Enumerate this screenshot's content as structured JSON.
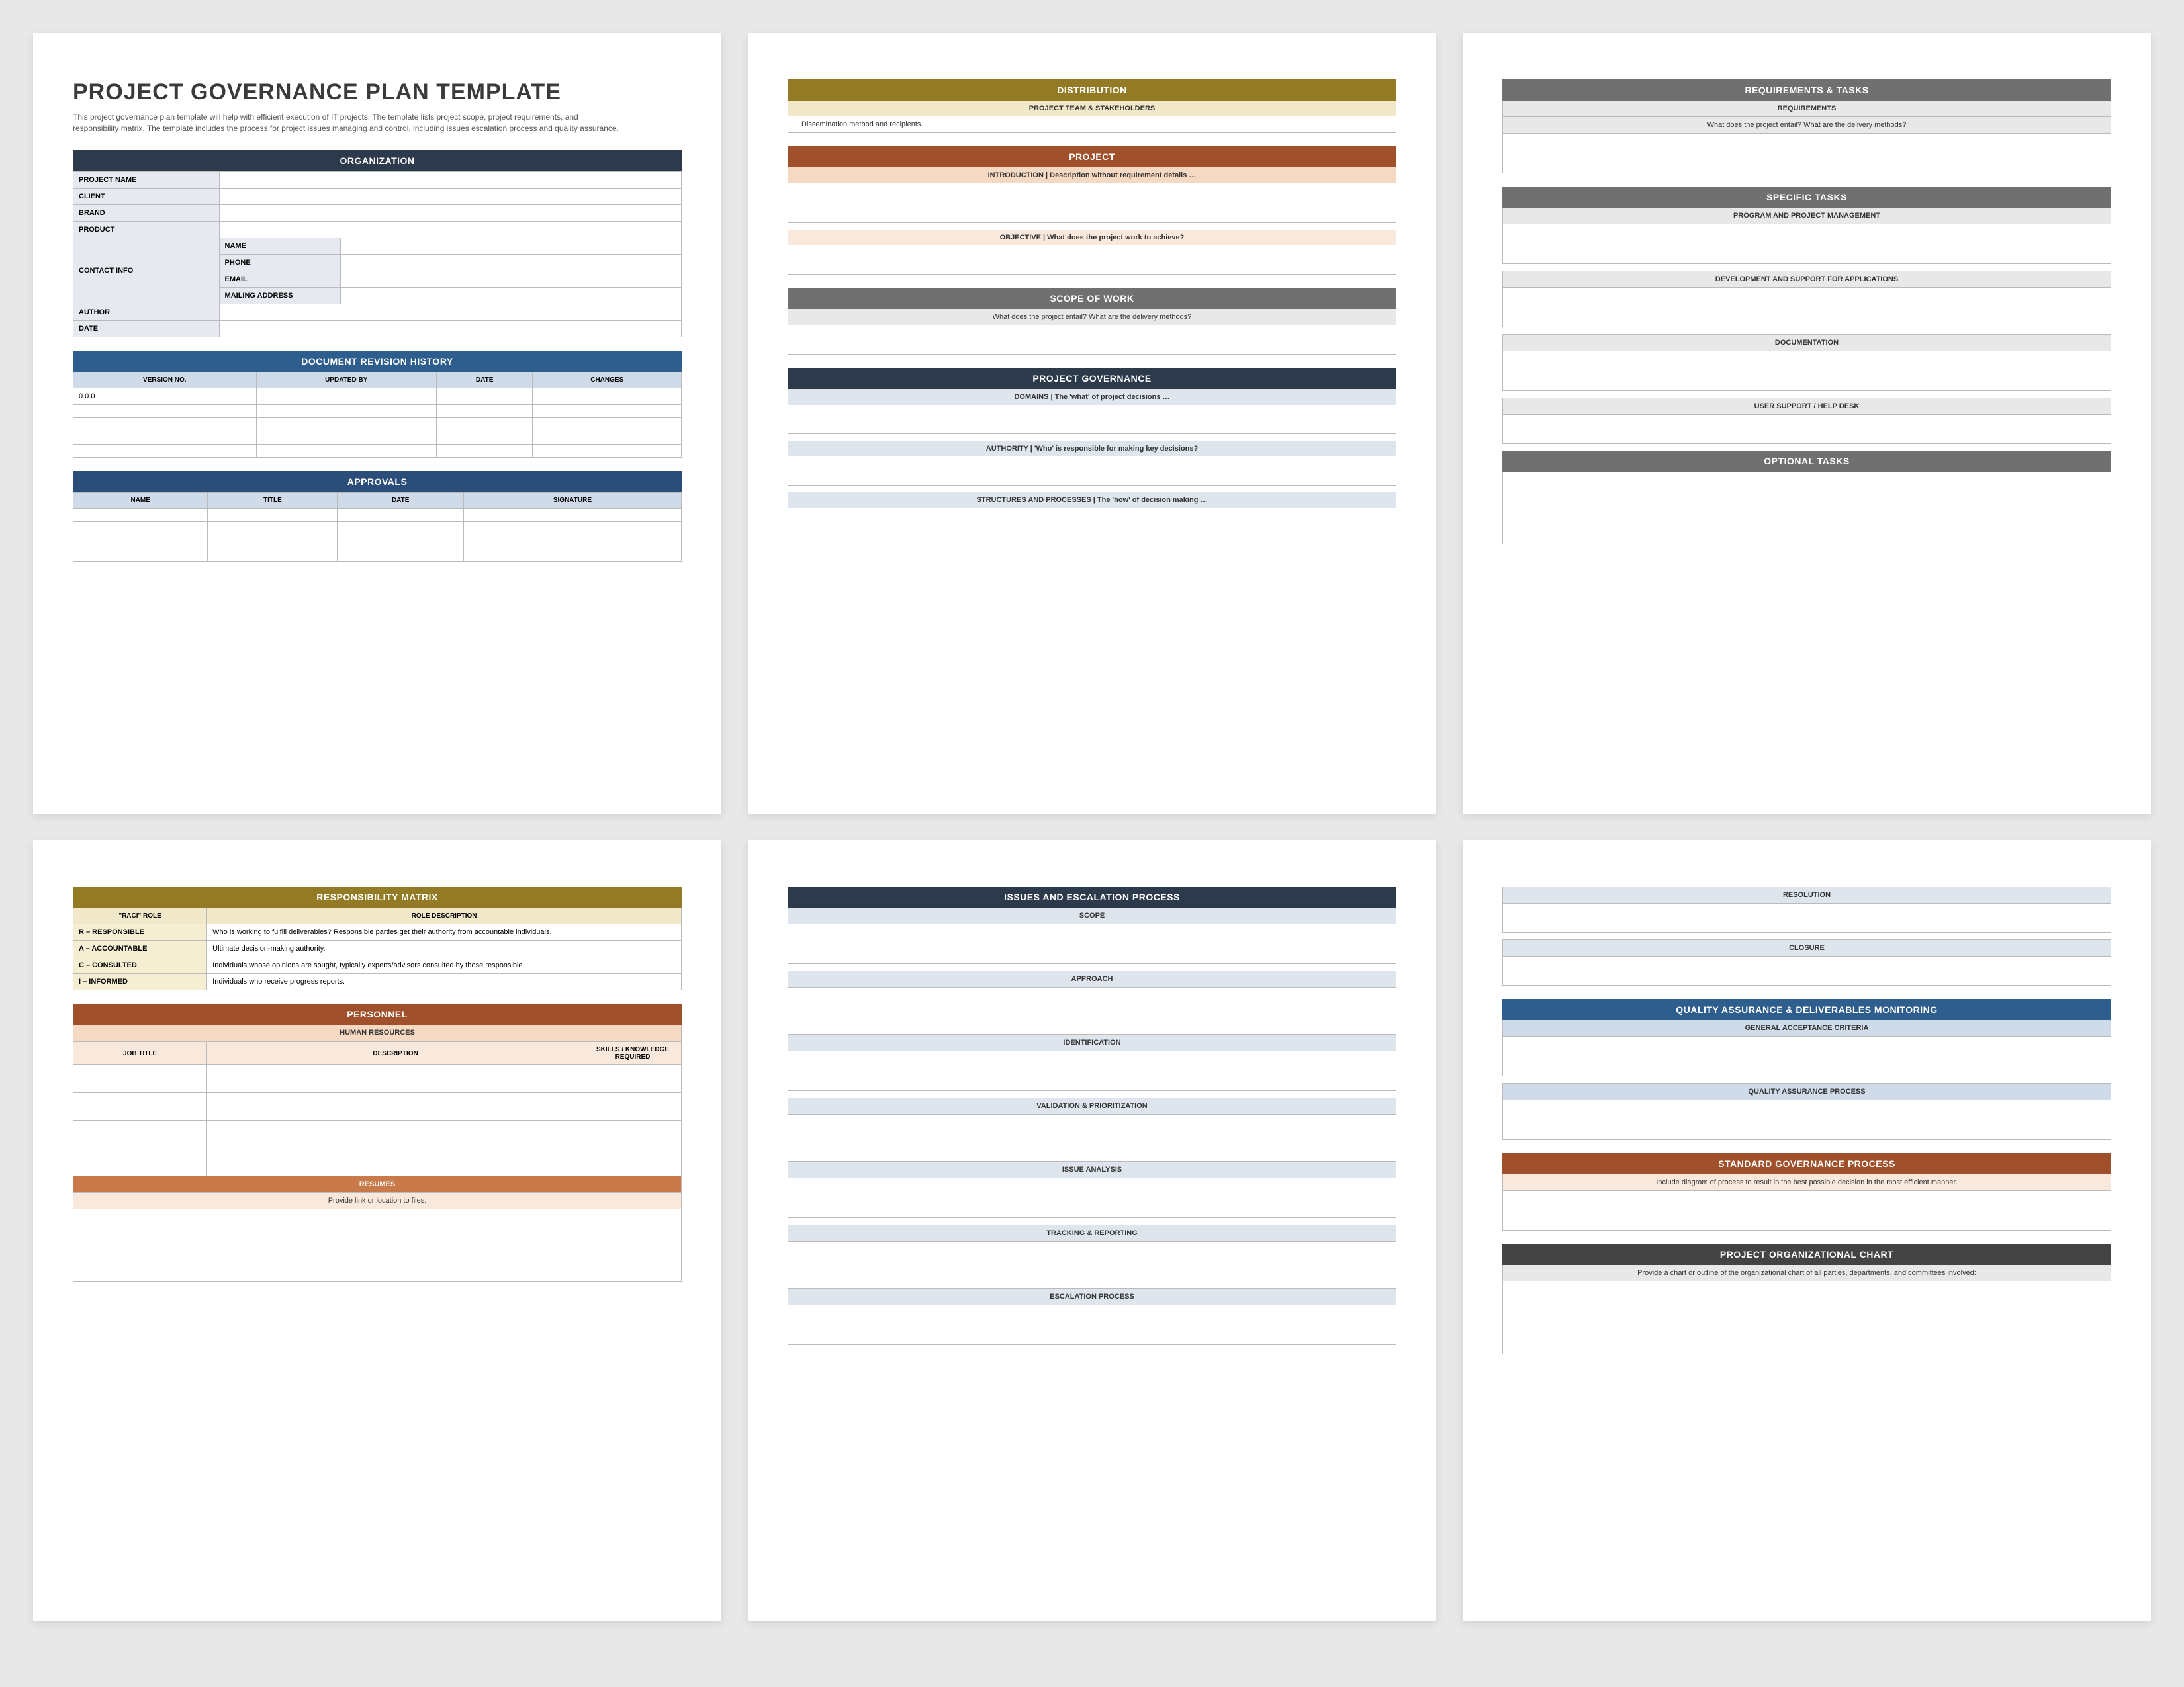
{
  "page1": {
    "title": "PROJECT GOVERNANCE PLAN TEMPLATE",
    "subtitle": "This project governance plan template will help with efficient execution of IT projects. The template lists project scope, project requirements, and responsibility matrix. The template includes the process for project issues managing and control, including issues escalation process and quality assurance.",
    "org_header": "ORGANIZATION",
    "fields": {
      "project_name": "PROJECT NAME",
      "client": "CLIENT",
      "brand": "BRAND",
      "product": "PRODUCT",
      "contact_info": "CONTACT INFO",
      "ci_name": "NAME",
      "ci_phone": "PHONE",
      "ci_email": "EMAIL",
      "ci_mail": "MAILING ADDRESS",
      "author": "AUTHOR",
      "date": "DATE"
    },
    "rev_header": "DOCUMENT REVISION HISTORY",
    "rev_cols": {
      "c1": "VERSION NO.",
      "c2": "UPDATED BY",
      "c3": "DATE",
      "c4": "CHANGES"
    },
    "rev_first": "0.0.0",
    "approvals_header": "APPROVALS",
    "appr_cols": {
      "c1": "NAME",
      "c2": "TITLE",
      "c3": "DATE",
      "c4": "SIGNATURE"
    }
  },
  "page2": {
    "dist_header": "DISTRIBUTION",
    "dist_sub": "PROJECT TEAM & STAKEHOLDERS",
    "dist_note": "Dissemination method and recipients.",
    "proj_header": "PROJECT",
    "intro_label": "INTRODUCTION  |  Description without requirement details …",
    "obj_label": "OBJECTIVE  |  What does the project work to achieve?",
    "scope_header": "SCOPE OF WORK",
    "scope_note": "What does the project entail? What are the delivery methods?",
    "gov_header": "PROJECT GOVERNANCE",
    "gov_domains": "DOMAINS  |  The 'what' of project decisions …",
    "gov_authority": "AUTHORITY  |  'Who' is responsible for making key decisions?",
    "gov_structures": "STRUCTURES AND PROCESSES  |  The 'how' of decision making …"
  },
  "page3": {
    "req_header": "REQUIREMENTS & TASKS",
    "req_sub": "REQUIREMENTS",
    "req_note": "What does the project entail? What are the delivery methods?",
    "tasks_header": "SPECIFIC TASKS",
    "t1": "PROGRAM AND PROJECT MANAGEMENT",
    "t2": "DEVELOPMENT AND SUPPORT FOR APPLICATIONS",
    "t3": "DOCUMENTATION",
    "t4": "USER SUPPORT / HELP DESK",
    "opt_header": "OPTIONAL TASKS"
  },
  "page4": {
    "resp_header": "RESPONSIBILITY MATRIX",
    "resp_cols": {
      "c1": "\"RACI\" ROLE",
      "c2": "ROLE DESCRIPTION"
    },
    "roles": {
      "r1": "R – RESPONSIBLE",
      "r1d": "Who is working to fulfill deliverables? Responsible parties get their authority from accountable individuals.",
      "r2": "A – ACCOUNTABLE",
      "r2d": "Ultimate decision-making authority.",
      "r3": "C – CONSULTED",
      "r3d": "Individuals whose opinions are sought, typically experts/advisors consulted by those responsible.",
      "r4": "I – INFORMED",
      "r4d": "Individuals who receive progress reports."
    },
    "pers_header": "PERSONNEL",
    "pers_sub": "HUMAN RESOURCES",
    "pers_cols": {
      "c1": "JOB TITLE",
      "c2": "DESCRIPTION",
      "c3": "SKILLS / KNOWLEDGE REQUIRED"
    },
    "resumes_header": "RESUMES",
    "resumes_note": "Provide link or location to files:"
  },
  "page5": {
    "iss_header": "ISSUES AND ESCALATION PROCESS",
    "s1": "SCOPE",
    "s2": "APPROACH",
    "s3": "IDENTIFICATION",
    "s4": "VALIDATION & PRIORITIZATION",
    "s5": "ISSUE ANALYSIS",
    "s6": "TRACKING & REPORTING",
    "s7": "ESCALATION PROCESS"
  },
  "page6": {
    "s1": "RESOLUTION",
    "s2": "CLOSURE",
    "qa_header": "QUALITY ASSURANCE & DELIVERABLES MONITORING",
    "qa1": "GENERAL ACCEPTANCE CRITERIA",
    "qa2": "QUALITY ASSURANCE PROCESS",
    "std_header": "STANDARD GOVERNANCE PROCESS",
    "std_note": "Include diagram of process to result in the best possible decision in the most efficient manner.",
    "org_header": "PROJECT ORGANIZATIONAL CHART",
    "org_note": "Provide a chart or outline of the organizational chart of all parties, departments, and committees involved:"
  }
}
